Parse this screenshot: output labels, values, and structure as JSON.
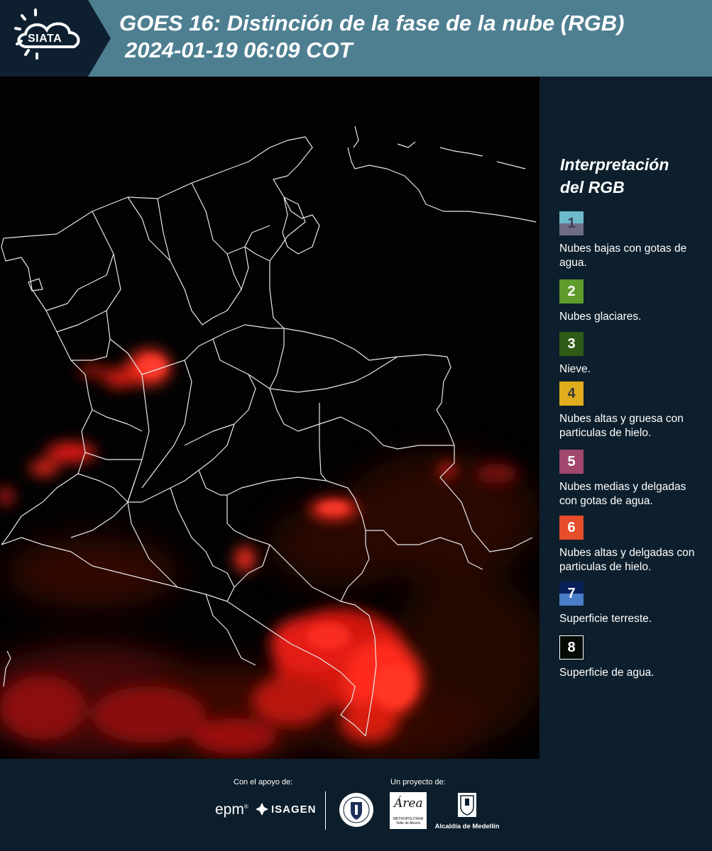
{
  "header": {
    "logo_text": "SIATA",
    "title_line1": "GOES 16: Distinción de la fase de la nube (RGB)",
    "title_line2": "2024-01-19 06:09 COT"
  },
  "legend": {
    "title_line1": "Interpretación",
    "title_line2": "del RGB",
    "items": [
      {
        "number": "1",
        "label": "Nubes bajas con gotas de agua.",
        "color_top": "#6dbacb",
        "color_bottom": "#6e6d85"
      },
      {
        "number": "2",
        "label": "Nubes glaciares.",
        "color": "#5e9c2c"
      },
      {
        "number": "3",
        "label": "Nieve.",
        "color": "#2f5b17"
      },
      {
        "number": "4",
        "label": "Nubes altas y gruesa con particulas de hielo.",
        "color": "#e0ae1c"
      },
      {
        "number": "5",
        "label": "Nubes medias y delgadas con gotas de agua.",
        "color": "#a1476e"
      },
      {
        "number": "6",
        "label": "Nubes altas y delgadas con particulas de hielo.",
        "color": "#e64d2a"
      },
      {
        "number": "7",
        "label": "Superficie terreste.",
        "color_top": "#08205a",
        "color_bottom": "#4a7dc8"
      },
      {
        "number": "8",
        "label": "Superficie de agua.",
        "color": "#050a05"
      }
    ]
  },
  "footer": {
    "support_label": "Con el apoyo de:",
    "project_label": "Un proyecto de:",
    "sponsor_1": "epm",
    "sponsor_2": "ISAGEN",
    "partner_area": "Área",
    "partner_area_sub": "METROPOLITANA Valle de Aburrá",
    "partner_alcaldia": "Alcaldía de Medellín"
  },
  "colors": {
    "header_bg": "#4e7f91",
    "panel_bg": "#0d1f2c",
    "cloud_red": "#ff2a1a"
  }
}
